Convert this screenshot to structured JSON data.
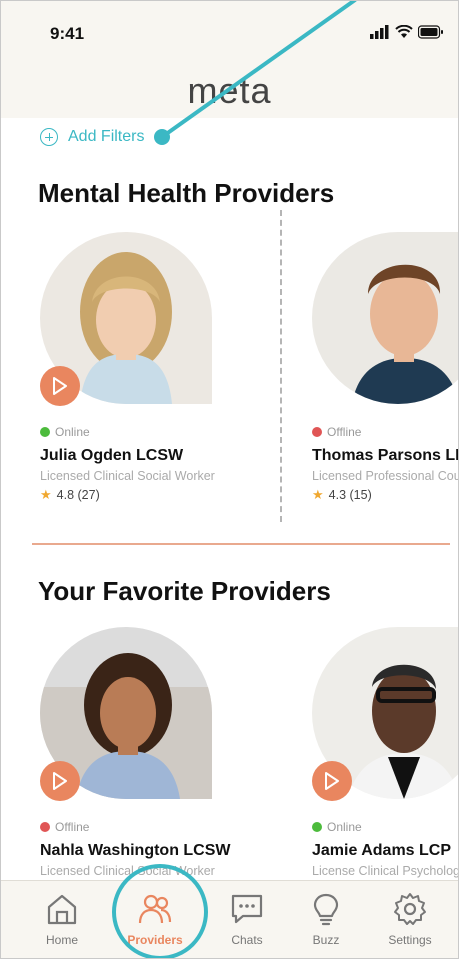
{
  "status_bar": {
    "time": "9:41"
  },
  "header": {
    "logo": "meta"
  },
  "filters": {
    "label": "Add Filters"
  },
  "sections": {
    "mental_health": {
      "title": "Mental Health Providers",
      "providers": [
        {
          "status": "Online",
          "status_color": "#4cbb3c",
          "name": "Julia Ogden LCSW",
          "title": "Licensed Clinical Social Worker",
          "rating": "4.8 (27)"
        },
        {
          "status": "Offline",
          "status_color": "#e05555",
          "name": "Thomas Parsons LPC",
          "title": "Licensed Professional Counselor",
          "rating": "4.3 (15)"
        }
      ]
    },
    "favorites": {
      "title": "Your Favorite Providers",
      "providers": [
        {
          "status": "Offline",
          "status_color": "#e05555",
          "name": "Nahla Washington LCSW",
          "title": "Licensed Clinical Social Worker"
        },
        {
          "status": "Online",
          "status_color": "#4cbb3c",
          "name": "Jamie Adams LCP",
          "title": "License Clinical Psychologist"
        }
      ]
    }
  },
  "tabbar": {
    "tabs": [
      {
        "label": "Home",
        "icon": "home-icon"
      },
      {
        "label": "Providers",
        "icon": "people-icon",
        "active": true
      },
      {
        "label": "Chats",
        "icon": "chat-icon"
      },
      {
        "label": "Buzz",
        "icon": "lightbulb-icon"
      },
      {
        "label": "Settings",
        "icon": "gear-icon"
      }
    ]
  },
  "colors": {
    "accent": "#e9865f",
    "teal": "#3bb8c4",
    "background": "#f8f6f1"
  }
}
